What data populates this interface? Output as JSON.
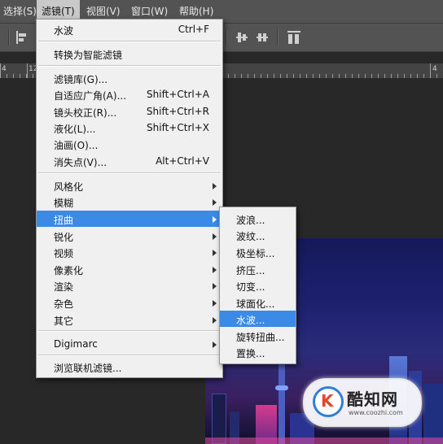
{
  "menubar": {
    "items": [
      {
        "label": "选择(S)"
      },
      {
        "label": "滤镜(T)",
        "active": true
      },
      {
        "label": "视图(V)"
      },
      {
        "label": "窗口(W)"
      },
      {
        "label": "帮助(H)"
      }
    ]
  },
  "ruler": {
    "numbers": [
      "4",
      "12",
      "4"
    ]
  },
  "filter_menu": {
    "items": [
      {
        "label": "水波",
        "shortcut": "Ctrl+F"
      },
      {
        "label": "转换为智能滤镜"
      },
      {
        "label": "滤镜库(G)..."
      },
      {
        "label": "自适应广角(A)...",
        "shortcut": "Shift+Ctrl+A"
      },
      {
        "label": "镜头校正(R)...",
        "shortcut": "Shift+Ctrl+R"
      },
      {
        "label": "液化(L)...",
        "shortcut": "Shift+Ctrl+X"
      },
      {
        "label": "油画(O)..."
      },
      {
        "label": "消失点(V)...",
        "shortcut": "Alt+Ctrl+V"
      },
      {
        "label": "风格化"
      },
      {
        "label": "模糊"
      },
      {
        "label": "扭曲",
        "highlighted": true
      },
      {
        "label": "锐化"
      },
      {
        "label": "视频"
      },
      {
        "label": "像素化"
      },
      {
        "label": "渲染"
      },
      {
        "label": "杂色"
      },
      {
        "label": "其它"
      },
      {
        "label": "Digimarc"
      },
      {
        "label": "浏览联机滤镜..."
      }
    ]
  },
  "distort_submenu": {
    "items": [
      {
        "label": "波浪..."
      },
      {
        "label": "波纹..."
      },
      {
        "label": "极坐标..."
      },
      {
        "label": "挤压..."
      },
      {
        "label": "切变..."
      },
      {
        "label": "球面化..."
      },
      {
        "label": "水波...",
        "highlighted": true
      },
      {
        "label": "旋转扭曲..."
      },
      {
        "label": "置换..."
      }
    ]
  },
  "watermark": {
    "name": "酷知网",
    "url": "www.coozhi.com"
  },
  "colors": {
    "menu_highlight": "#3b8ae6",
    "menubar": "#535353",
    "workspace": "#282828"
  }
}
